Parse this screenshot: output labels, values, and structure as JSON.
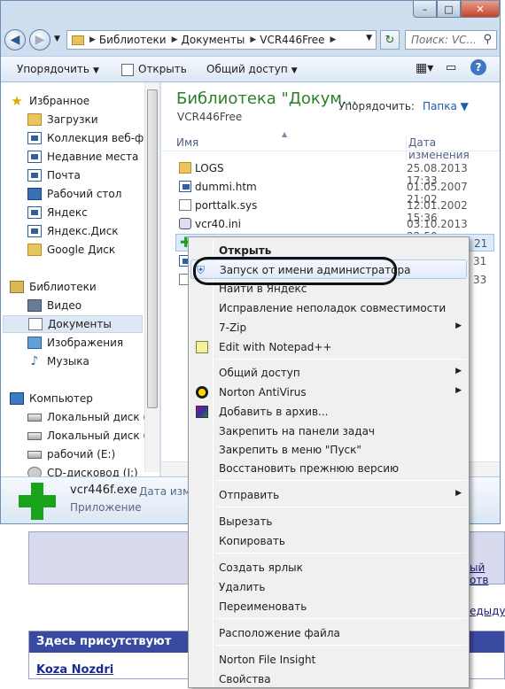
{
  "window": {
    "caption_buttons": {
      "minimize": "–",
      "maximize": "□",
      "close": "✕"
    }
  },
  "nav": {
    "breadcrumbs": [
      "Библиотеки",
      "Документы",
      "VCR446Free"
    ],
    "search_placeholder": "Поиск: VC...",
    "icons": {
      "back": "back-arrow-icon",
      "forward": "forward-arrow-icon",
      "refresh": "refresh-icon",
      "search": "search-icon"
    }
  },
  "toolbar": {
    "organize": "Упорядочить",
    "open": "Открыть",
    "share": "Общий доступ"
  },
  "sidebar": {
    "favorites": {
      "header": "Избранное",
      "items": [
        "Загрузки",
        "Коллекция веб-фра",
        "Недавние места",
        "Почта",
        "Рабочий стол",
        "Яндекс",
        "Яндекс.Диск",
        "Google Диск"
      ]
    },
    "libraries": {
      "header": "Библиотеки",
      "items": [
        "Видео",
        "Документы",
        "Изображения",
        "Музыка"
      ],
      "selected": "Документы"
    },
    "computer": {
      "header": "Компьютер",
      "items": [
        "Локальный диск (C:",
        "Локальный диск (D:",
        "рабочий (E:)",
        "CD-дисковод (J:)"
      ]
    }
  },
  "content": {
    "library_title": "Библиотека \"Докум...",
    "library_subtitle": "VCR446Free",
    "arrange_label": "Упорядочить:",
    "arrange_value": "Папка",
    "columns": {
      "name": "Имя",
      "date": "Дата изменения"
    },
    "files": [
      {
        "name": "LOGS",
        "date": "25.08.2013 17:33",
        "icon": "folder-icon"
      },
      {
        "name": "dummi.htm",
        "date": "01.05.2007 21:02",
        "icon": "html-file-icon"
      },
      {
        "name": "porttalk.sys",
        "date": "12.01.2002 15:36",
        "icon": "system-file-icon"
      },
      {
        "name": "vcr40.ini",
        "date": "03.10.2013 22:50",
        "icon": "settings-file-icon"
      }
    ],
    "partial_dates": [
      "21",
      "31",
      "33"
    ]
  },
  "details": {
    "filename": "vcr446f.exe",
    "type": "Приложение",
    "date_label": "Дата измене"
  },
  "context_menu": {
    "items": [
      {
        "label": "Открыть",
        "bold": true
      },
      {
        "label": "Запуск от имени администратора",
        "icon": "shield-icon"
      },
      {
        "label": "Найти в Яндекс"
      },
      {
        "label": "Исправление неполадок совместимости"
      },
      {
        "label": "7-Zip",
        "submenu": true
      },
      {
        "label": "Edit with Notepad++",
        "icon": "notepad-icon"
      },
      {
        "label": "Общий доступ",
        "submenu": true
      },
      {
        "label": "Norton AntiVirus",
        "submenu": true,
        "icon": "norton-icon"
      },
      {
        "label": "Добавить в архив...",
        "icon": "winrar-icon"
      },
      {
        "label": "Закрепить на панели задач"
      },
      {
        "label": "Закрепить в меню \"Пуск\""
      },
      {
        "label": "Восстановить прежнюю версию"
      },
      {
        "label": "Отправить",
        "submenu": true
      },
      {
        "label": "Вырезать"
      },
      {
        "label": "Копировать"
      },
      {
        "label": "Создать ярлык"
      },
      {
        "label": "Удалить"
      },
      {
        "label": "Переименовать"
      },
      {
        "label": "Расположение файла"
      },
      {
        "label": "Norton File Insight"
      },
      {
        "label": "Свойства"
      }
    ]
  },
  "webpage": {
    "side_text_1": "ый отв",
    "side_text_2": "едыдущ",
    "present_header": "Здесь присутствуют",
    "user_link": "Koza Nozdri"
  },
  "colors": {
    "accent_green": "#2a7f2a",
    "link_blue": "#1d5ca8",
    "panel_header": "#3a4aa0"
  }
}
